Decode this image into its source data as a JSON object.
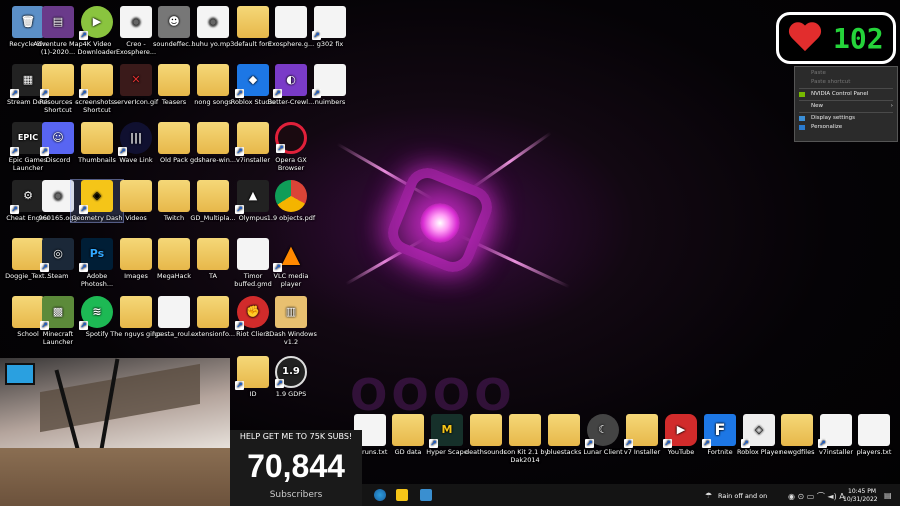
{
  "desktop": {
    "col1": [
      "Recycle Bin",
      "Stream Deck",
      "Epic Games Launcher",
      "Cheat Engine",
      "Doggie_Text...",
      "School"
    ],
    "col2": [
      "Adventure Map (1)-2020...",
      "Resources - Shortcut",
      "Discord",
      "960165.ogg",
      "Steam",
      "Minecraft Launcher"
    ],
    "col3": [
      "4K Video Downloader",
      "screenshots - Shortcut",
      "Thumbnails",
      "Geometry Dash",
      "Adobe Photosh...",
      "Spotify"
    ],
    "col4": [
      "Creo - Exosphere...",
      "serverIcon.gif",
      "Wave Link",
      "Videos",
      "Images",
      "The nguys gifgs"
    ],
    "col5": [
      "soundeffec...",
      "Teasers",
      "Old Pack",
      "Twitch",
      "MegaHack",
      "npesta_roul..."
    ],
    "col6": [
      "huhu yo.mp3",
      "nong songs",
      "gdshare-win...",
      "GD_Multipla...",
      "TA",
      "extensionfo..."
    ],
    "col7": [
      "default font",
      "Roblox Studio",
      "v7installer",
      "Olympus",
      "Timor buffed.gmd",
      "Riot Client",
      "ID"
    ],
    "col8": [
      "Exosphere.g...",
      "Better-Crewl...",
      "Opera GX Browser",
      "1.9 objects.pdf",
      "VLC media player",
      "3Dash Windows v1.2",
      "1.9 GDPS"
    ],
    "col9": [
      "g302 fix",
      "nuimbers"
    ],
    "bottom_row": [
      "os runs.txt",
      "GD data",
      "Hyper Scape",
      "deathsounds",
      "Icon Kit 2.1 by Dak2014",
      "bluestacks",
      "Lunar Client",
      "v7 Installer",
      "YouTube",
      "Fortnite",
      "Roblox Player",
      "newgdfiles",
      "v7installer",
      "players.txt"
    ]
  },
  "heart_counter": {
    "value": "102"
  },
  "context_menu": {
    "items": [
      "Paste",
      "Paste shortcut",
      "NVIDIA Control Panel",
      "New",
      "Display settings",
      "Personalize"
    ]
  },
  "sub_counter": {
    "goal": "HELP GET ME TO 75K SUBS!",
    "count": "70,844",
    "label": "Subscribers"
  },
  "taskbar": {
    "weather": "Rain off and on",
    "time": "10:45 PM",
    "date": "10/31/2022"
  },
  "colors": {
    "heart": "#e22d2d",
    "counter_green": "#25d43a",
    "glow": "#d02ad0"
  }
}
